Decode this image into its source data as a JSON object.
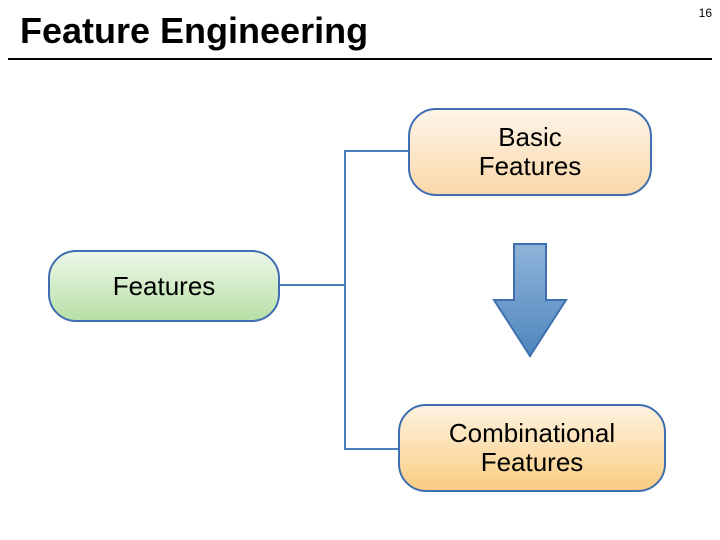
{
  "page_number": "16",
  "title": "Feature Engineering",
  "nodes": {
    "basic": "Basic\nFeatures",
    "features": "Features",
    "combinational": "Combinational\nFeatures"
  },
  "colors": {
    "arrow_fill": "#5b8ec1",
    "arrow_stroke": "#3f6fb0",
    "connector": "#4a7ebb"
  }
}
